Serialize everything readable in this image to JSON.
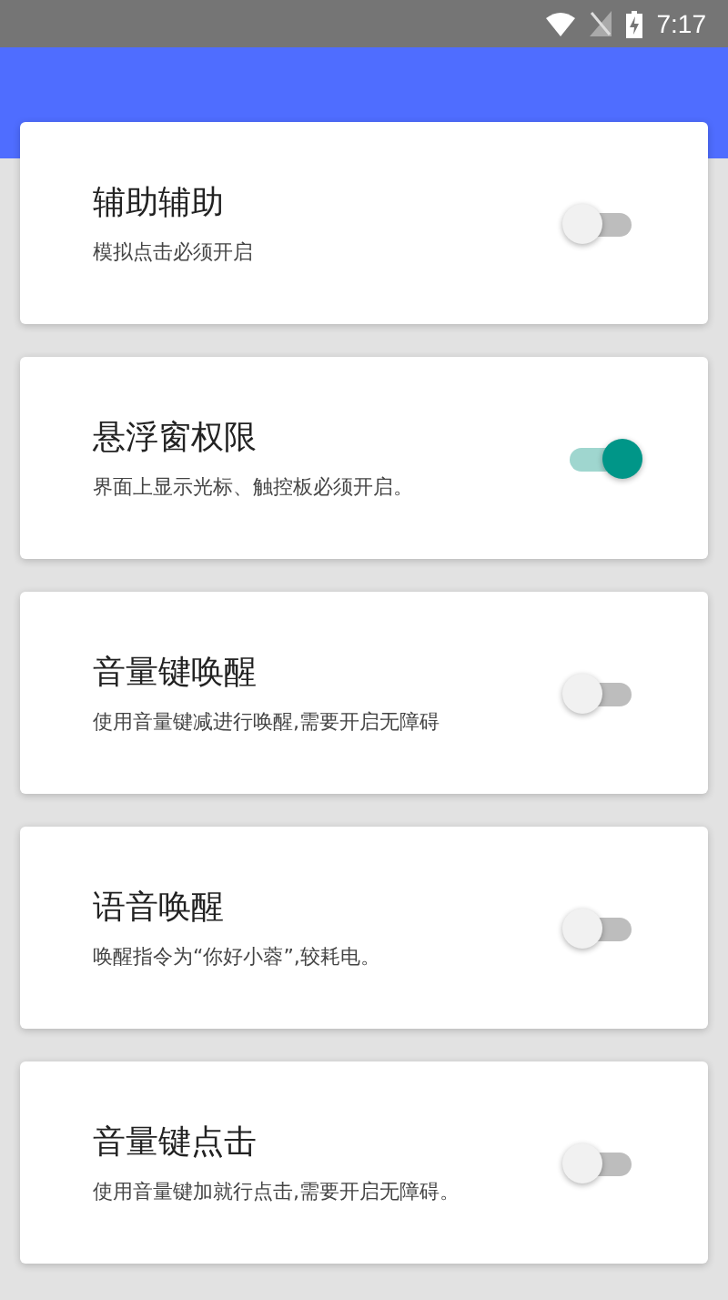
{
  "status_bar": {
    "time": "7:17"
  },
  "settings": [
    {
      "title": "辅助辅助",
      "description": "模拟点击必须开启",
      "on": false
    },
    {
      "title": "悬浮窗权限",
      "description": "界面上显示光标、触控板必须开启。",
      "on": true
    },
    {
      "title": "音量键唤醒",
      "description": "使用音量键减进行唤醒,需要开启无障碍",
      "on": false
    },
    {
      "title": "语音唤醒",
      "description": "唤醒指令为“你好小蓉”,较耗电。",
      "on": false
    },
    {
      "title": "音量键点击",
      "description": "使用音量键加就行点击,需要开启无障碍。",
      "on": false
    }
  ]
}
